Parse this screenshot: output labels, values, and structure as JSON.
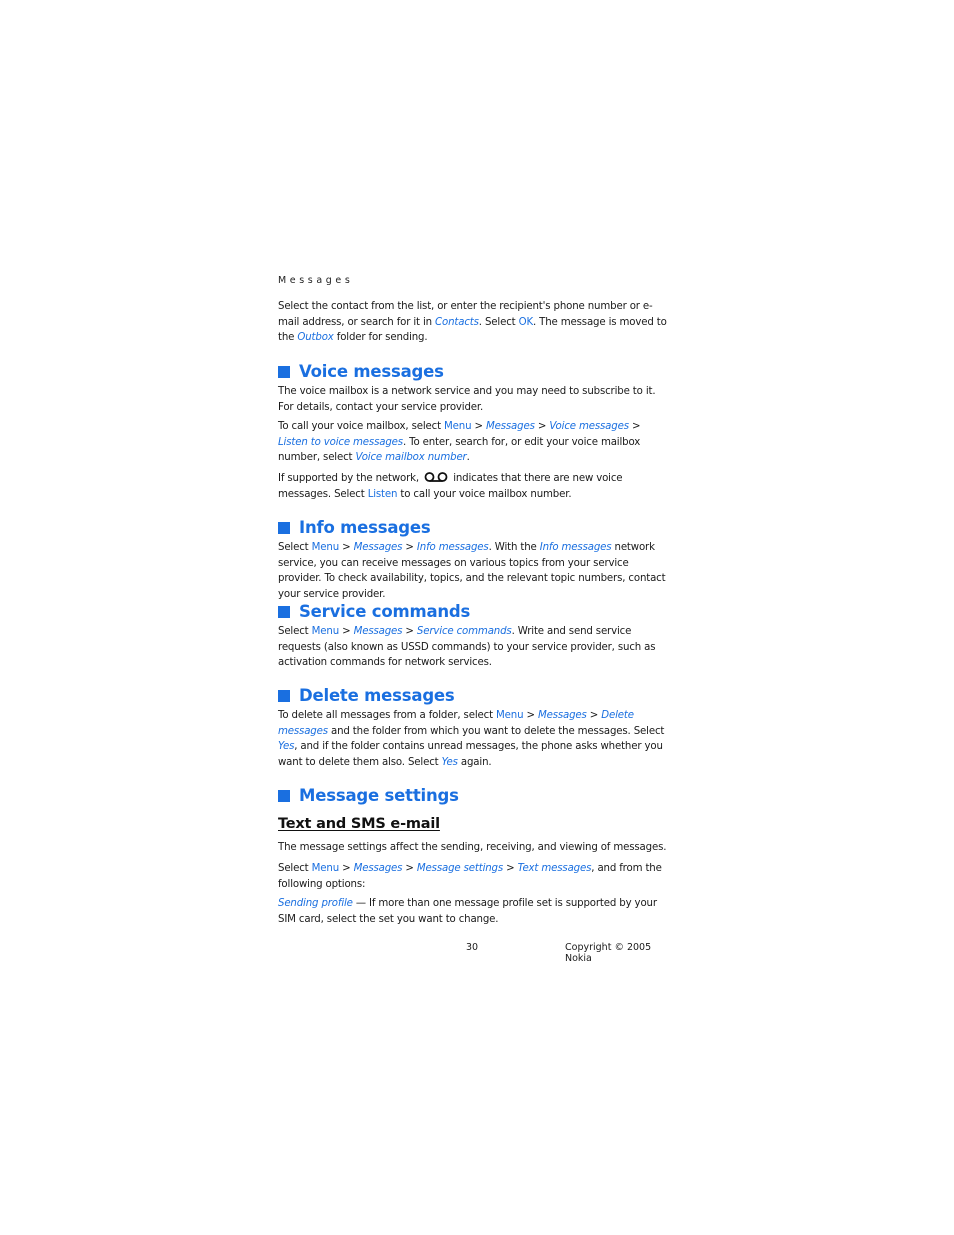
{
  "running_head": "Messages",
  "intro": {
    "t1": "Select the contact from the list, or enter the recipient's phone number or e-mail address, or search for it in ",
    "l1": "Contacts",
    "t2": ". Select ",
    "l2": "OK",
    "t3": ". The message is moved to the ",
    "l3": "Outbox",
    "t4": " folder for sending."
  },
  "voice": {
    "heading": "Voice messages",
    "p1": "The voice mailbox is a network service and you may need to subscribe to it. For details, contact your service provider.",
    "p2": {
      "t1": "To call your voice mailbox, select ",
      "menu": "Menu",
      "sep": " > ",
      "messages": "Messages",
      "voice_messages": "Voice messages",
      "listen": "Listen to voice messages",
      "t2": ". To enter, search for, or edit your voice mailbox number, select ",
      "mailbox_number": "Voice mailbox number",
      "t3": "."
    },
    "p3": {
      "t1": "If supported by the network, ",
      "icon": "voicemail-icon",
      "t2": " indicates that there are new voice messages. Select ",
      "listen": "Listen",
      "t3": " to call your voice mailbox number."
    }
  },
  "info": {
    "heading": "Info messages",
    "t1": "Select ",
    "menu": "Menu",
    "sep": " > ",
    "messages": "Messages",
    "info_messages": "Info messages",
    "t2": ". With the ",
    "info_messages2": "Info messages",
    "t3": " network service, you can receive messages on various topics from your service provider. To check availability, topics, and the relevant topic numbers, contact your service provider."
  },
  "service": {
    "heading": "Service commands",
    "t1": "Select ",
    "menu": "Menu",
    "sep": " > ",
    "messages": "Messages",
    "service_commands": "Service commands",
    "t2": ". Write and send service requests (also known as USSD commands) to your service provider, such as activation commands for network services."
  },
  "delete": {
    "heading": "Delete messages",
    "t1": "To delete all messages from a folder, select ",
    "menu": "Menu",
    "sep": " > ",
    "messages": "Messages",
    "delete_messages": "Delete messages",
    "t2": " and the folder from which you want to delete the messages. Select ",
    "yes": "Yes",
    "t3": ", and if the folder contains unread messages, the phone asks whether you want to delete them also. Select ",
    "yes2": "Yes",
    "t4": " again."
  },
  "settings": {
    "heading": "Message settings",
    "subheading": "Text and SMS e-mail",
    "p1": "The message settings affect the sending, receiving, and viewing of messages.",
    "p2": {
      "t1": "Select ",
      "menu": "Menu",
      "sep": " > ",
      "messages": "Messages",
      "message_settings": "Message settings",
      "text_messages": "Text messages",
      "t2": ", and from the following options:"
    },
    "p3": {
      "sending_profile": "Sending profile",
      "t1": " — If more than one message profile set is supported by your SIM card, select the set you want to change."
    }
  },
  "footer": {
    "page_number": "30",
    "copyright": "Copyright © 2005 Nokia"
  },
  "colors": {
    "link": "#1a6fe0",
    "text": "#1a1a1a"
  }
}
